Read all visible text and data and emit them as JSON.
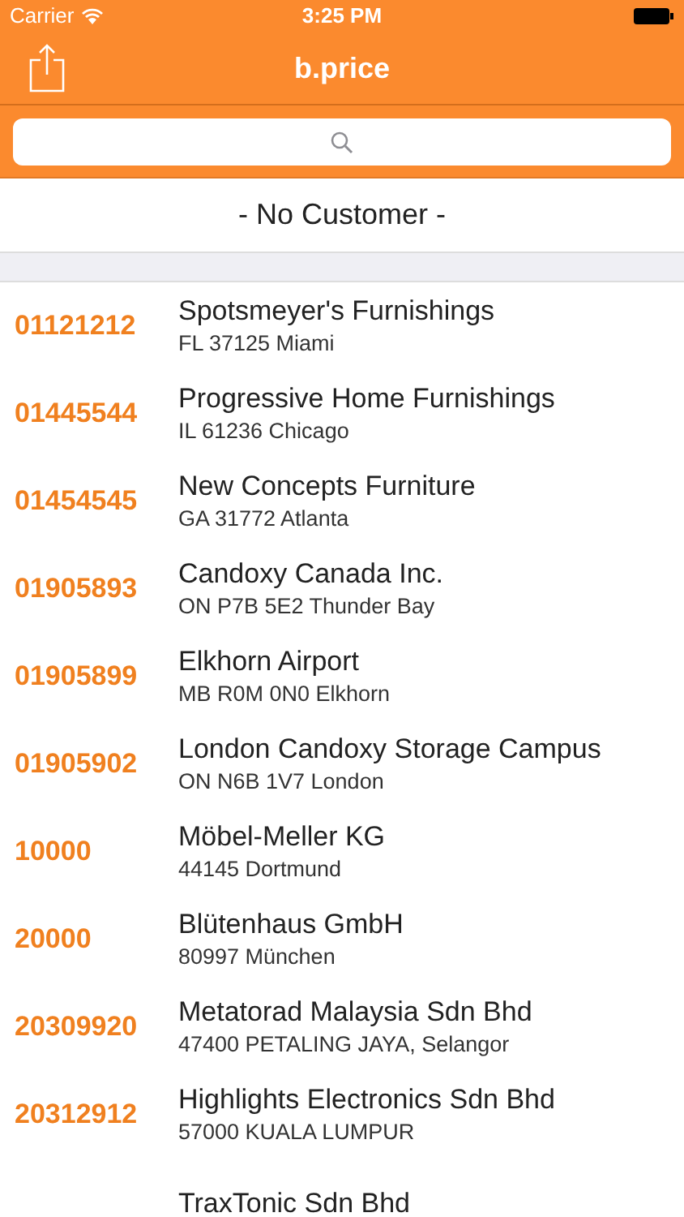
{
  "status_bar": {
    "carrier": "Carrier",
    "time": "3:25 PM"
  },
  "nav": {
    "title": "b.price"
  },
  "customer": {
    "label": "- No Customer -"
  },
  "rows": [
    {
      "number": "01121212",
      "name": "Spotsmeyer's Furnishings",
      "address": "FL 37125 Miami"
    },
    {
      "number": "01445544",
      "name": "Progressive Home Furnishings",
      "address": "IL 61236 Chicago"
    },
    {
      "number": "01454545",
      "name": "New Concepts Furniture",
      "address": "GA 31772 Atlanta"
    },
    {
      "number": "01905893",
      "name": "Candoxy Canada Inc.",
      "address": "ON P7B 5E2 Thunder Bay"
    },
    {
      "number": "01905899",
      "name": "Elkhorn Airport",
      "address": "MB R0M 0N0 Elkhorn"
    },
    {
      "number": "01905902",
      "name": "London Candoxy Storage Campus",
      "address": "ON N6B 1V7 London"
    },
    {
      "number": "10000",
      "name": "Möbel-Meller KG",
      "address": "44145 Dortmund"
    },
    {
      "number": "20000",
      "name": "Blütenhaus GmbH",
      "address": "80997 München"
    },
    {
      "number": "20309920",
      "name": "Metatorad Malaysia Sdn Bhd",
      "address": "47400 PETALING JAYA, Selangor"
    },
    {
      "number": "20312912",
      "name": "Highlights Electronics Sdn Bhd",
      "address": "57000 KUALA LUMPUR"
    },
    {
      "name": "TraxTonic Sdn Bhd"
    }
  ]
}
